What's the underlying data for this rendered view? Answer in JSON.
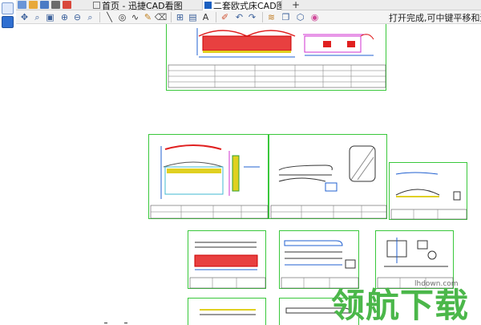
{
  "tabs": [
    {
      "label": "首页 - 迅捷CAD看图",
      "active": false
    },
    {
      "label": "二套欧式床CAD图",
      "active": true
    }
  ],
  "tab_close": "×",
  "tab_add": "+",
  "status_message": "打开完成,可中键平移和滚轮",
  "watermark": {
    "text": "领航下载",
    "url": "lhdown.com"
  },
  "colors": {
    "accent": "#1a5fc0",
    "drawing_border": "#39c83b",
    "watermark": "#4bb74a"
  },
  "toolbar_icons": [
    "move-icon",
    "zoom-region-icon",
    "zoom-window-icon",
    "zoom-in-icon",
    "zoom-out-icon",
    "zoom-fit-icon",
    "line-icon",
    "circle-icon",
    "polyline-icon",
    "pencil-icon",
    "erase-icon",
    "layout-icon",
    "text-icon",
    "text-style-icon",
    "pen-icon",
    "undo-icon",
    "redo-icon",
    "layers-icon",
    "blocks-icon",
    "3d-icon",
    "color-icon"
  ]
}
